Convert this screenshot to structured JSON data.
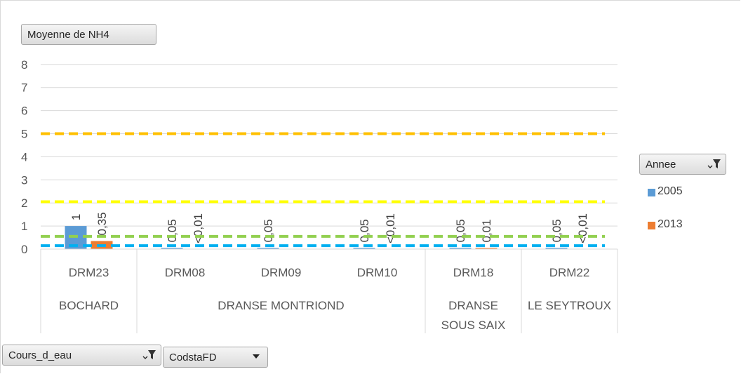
{
  "value_field_button": "Moyenne de NH4",
  "legend": {
    "field_button": "Annee",
    "items": [
      {
        "label": "2005",
        "color": "#5b9bd5"
      },
      {
        "label": "2013",
        "color": "#ed7d31"
      }
    ]
  },
  "axis_field_buttons": [
    {
      "label": "Cours_d_eau",
      "icon": "filter-dropdown-icon"
    },
    {
      "label": "CodstaFD",
      "icon": "dropdown-arrow-icon"
    }
  ],
  "chart_data": {
    "type": "bar",
    "ylim": [
      0,
      8
    ],
    "yticks": [
      "0",
      "1",
      "2",
      "3",
      "4",
      "5",
      "6",
      "7",
      "8"
    ],
    "grid": true,
    "legend_position": "right",
    "categories": [
      "DRM23",
      "DRM08",
      "DRM09",
      "DRM10",
      "DRM18",
      "DRM22"
    ],
    "groups": [
      {
        "label": "BOCHARD",
        "span": 1
      },
      {
        "label": "DRANSE MONTRIOND",
        "span": 3
      },
      {
        "label": "DRANSE SOUS SAIX",
        "lines": [
          "DRANSE",
          "SOUS SAIX"
        ],
        "span": 1
      },
      {
        "label": "LE SEYTROUX",
        "span": 1
      }
    ],
    "series": [
      {
        "name": "2005",
        "color": "#5b9bd5",
        "values": [
          1,
          0.05,
          0.05,
          0.05,
          0.05,
          0.05
        ],
        "labels": [
          "1",
          "0,05",
          "0,05",
          "0,05",
          "0,05",
          "0,05"
        ]
      },
      {
        "name": "2013",
        "color": "#ed7d31",
        "values": [
          0.35,
          null,
          null,
          null,
          0.01,
          null
        ],
        "labels": [
          "0,35",
          "<0,01",
          "",
          "<0,01",
          "0,01",
          "<0,01"
        ]
      }
    ],
    "reference_lines": [
      {
        "value": 5,
        "color": "#ffc000"
      },
      {
        "value": 2.05,
        "color": "#ffff00"
      },
      {
        "value": 0.55,
        "color": "#92d050"
      },
      {
        "value": 0.15,
        "color": "#00b0f0"
      }
    ]
  }
}
